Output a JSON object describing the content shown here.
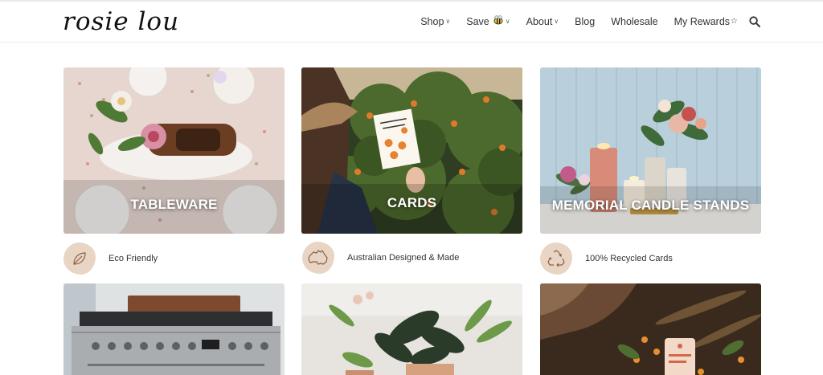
{
  "brand": {
    "logo_text": "rosie lou"
  },
  "nav": {
    "shop": "Shop",
    "save": "Save",
    "about": "About",
    "blog": "Blog",
    "wholesale": "Wholesale",
    "rewards": "My Rewards"
  },
  "categories": [
    {
      "label": "TABLEWARE"
    },
    {
      "label": "CARDS"
    },
    {
      "label": "MEMORIAL CANDLE STANDS"
    }
  ],
  "features": [
    {
      "label": "Eco Friendly",
      "icon": "leaf-icon"
    },
    {
      "label": "Australian Designed & Made",
      "icon": "australia-map-icon"
    },
    {
      "label": "100% Recycled Cards",
      "icon": "recycle-icon"
    }
  ],
  "colors": {
    "badge_bg": "#e8d5c4",
    "icon_stroke": "#8b5e45",
    "header_border": "#ececec"
  }
}
